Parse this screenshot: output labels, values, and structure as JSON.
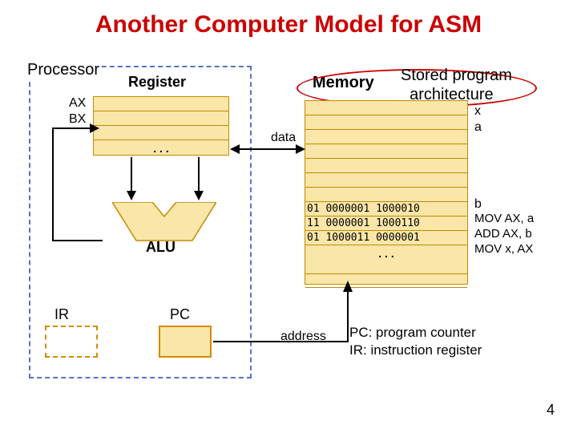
{
  "title": "Another Computer Model for ASM",
  "processor": {
    "label": "Processor"
  },
  "register": {
    "label": "Register",
    "names": {
      "ax": "AX",
      "bx": "BX"
    },
    "dots": ". . ."
  },
  "alu": {
    "label": "ALU"
  },
  "ir": {
    "label": "IR"
  },
  "pc": {
    "label": "PC"
  },
  "memory": {
    "label": "Memory",
    "stored_line1": "Stored program",
    "stored_line2": "architecture",
    "data_label": "data",
    "address_label": "address",
    "vars": {
      "x": "x",
      "a": "a",
      "b": "b"
    },
    "code": [
      "01 0000001 1000010",
      "11 0000001 1000110",
      "01 1000011 0000001"
    ],
    "instructions": [
      "MOV AX, a",
      "ADD AX, b",
      "MOV x, AX"
    ],
    "dots": ". . ."
  },
  "note": {
    "pc": "PC: program counter",
    "ir": "IR: instruction register"
  },
  "slide_num": "4"
}
